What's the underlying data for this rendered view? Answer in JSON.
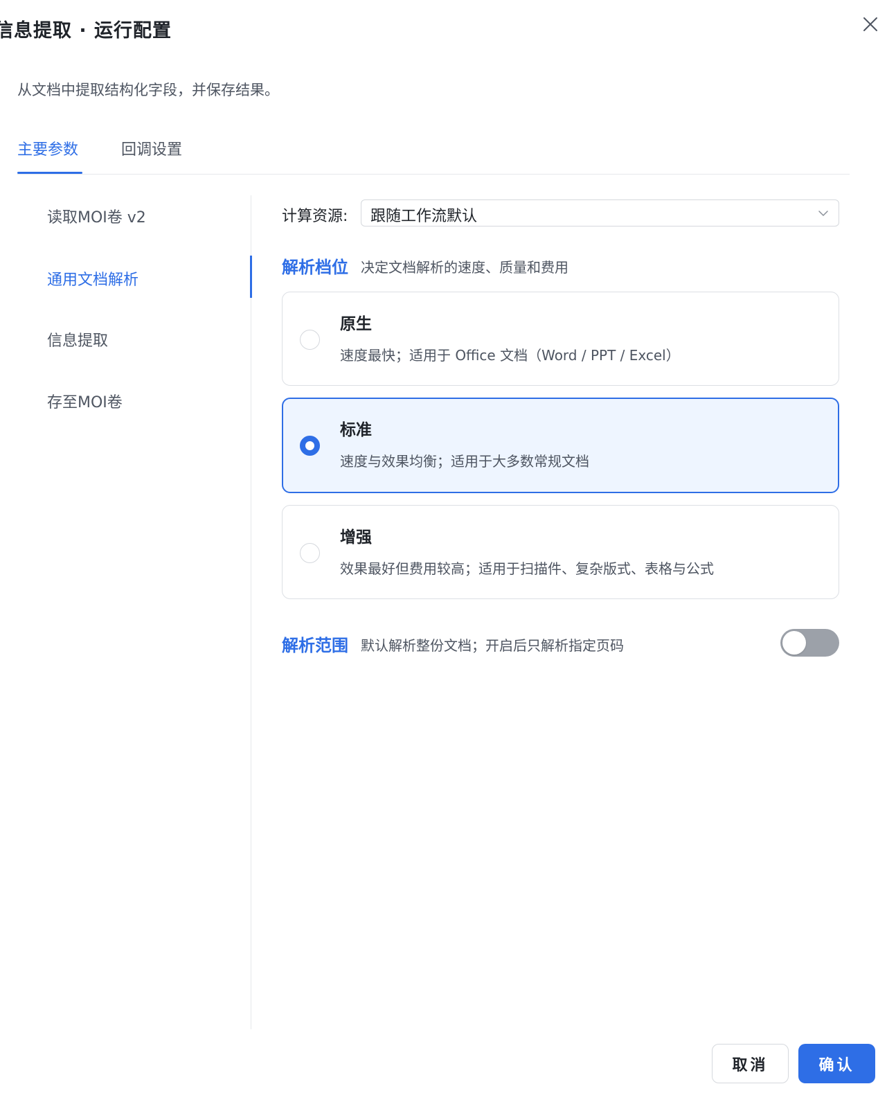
{
  "dialog": {
    "title": "信息提取 · 运行配置",
    "description": "从文档中提取结构化字段，并保存结果。",
    "close_icon": "close-icon"
  },
  "tabs": [
    {
      "label": "主要参数",
      "active": true
    },
    {
      "label": "回调设置",
      "active": false
    }
  ],
  "nav": {
    "items": [
      {
        "label": "读取MOI卷 v2",
        "active": false
      },
      {
        "label": "通用文档解析",
        "active": true
      },
      {
        "label": "信息提取",
        "active": false
      },
      {
        "label": "存至MOI卷",
        "active": false
      }
    ]
  },
  "compute": {
    "label": "计算资源:",
    "value": "跟随工作流默认",
    "icon": "chevron-down-icon"
  },
  "parse_level": {
    "title": "解析档位",
    "subtitle": "决定文档解析的速度、质量和费用",
    "options": [
      {
        "title": "原生",
        "desc": "速度最快；适用于 Office 文档（Word / PPT / Excel）",
        "selected": false
      },
      {
        "title": "标准",
        "desc": "速度与效果均衡；适用于大多数常规文档",
        "selected": true
      },
      {
        "title": "增强",
        "desc": "效果最好但费用较高；适用于扫描件、复杂版式、表格与公式",
        "selected": false
      }
    ]
  },
  "parse_range": {
    "title": "解析范围",
    "subtitle": "默认解析整份文档；开启后只解析指定页码",
    "enabled": false
  },
  "footer": {
    "cancel": "取消",
    "confirm": "确认"
  },
  "colors": {
    "accent": "#2e6ee6",
    "selected_bg": "#eef5ff",
    "toggle_off": "#9ca1a9"
  }
}
